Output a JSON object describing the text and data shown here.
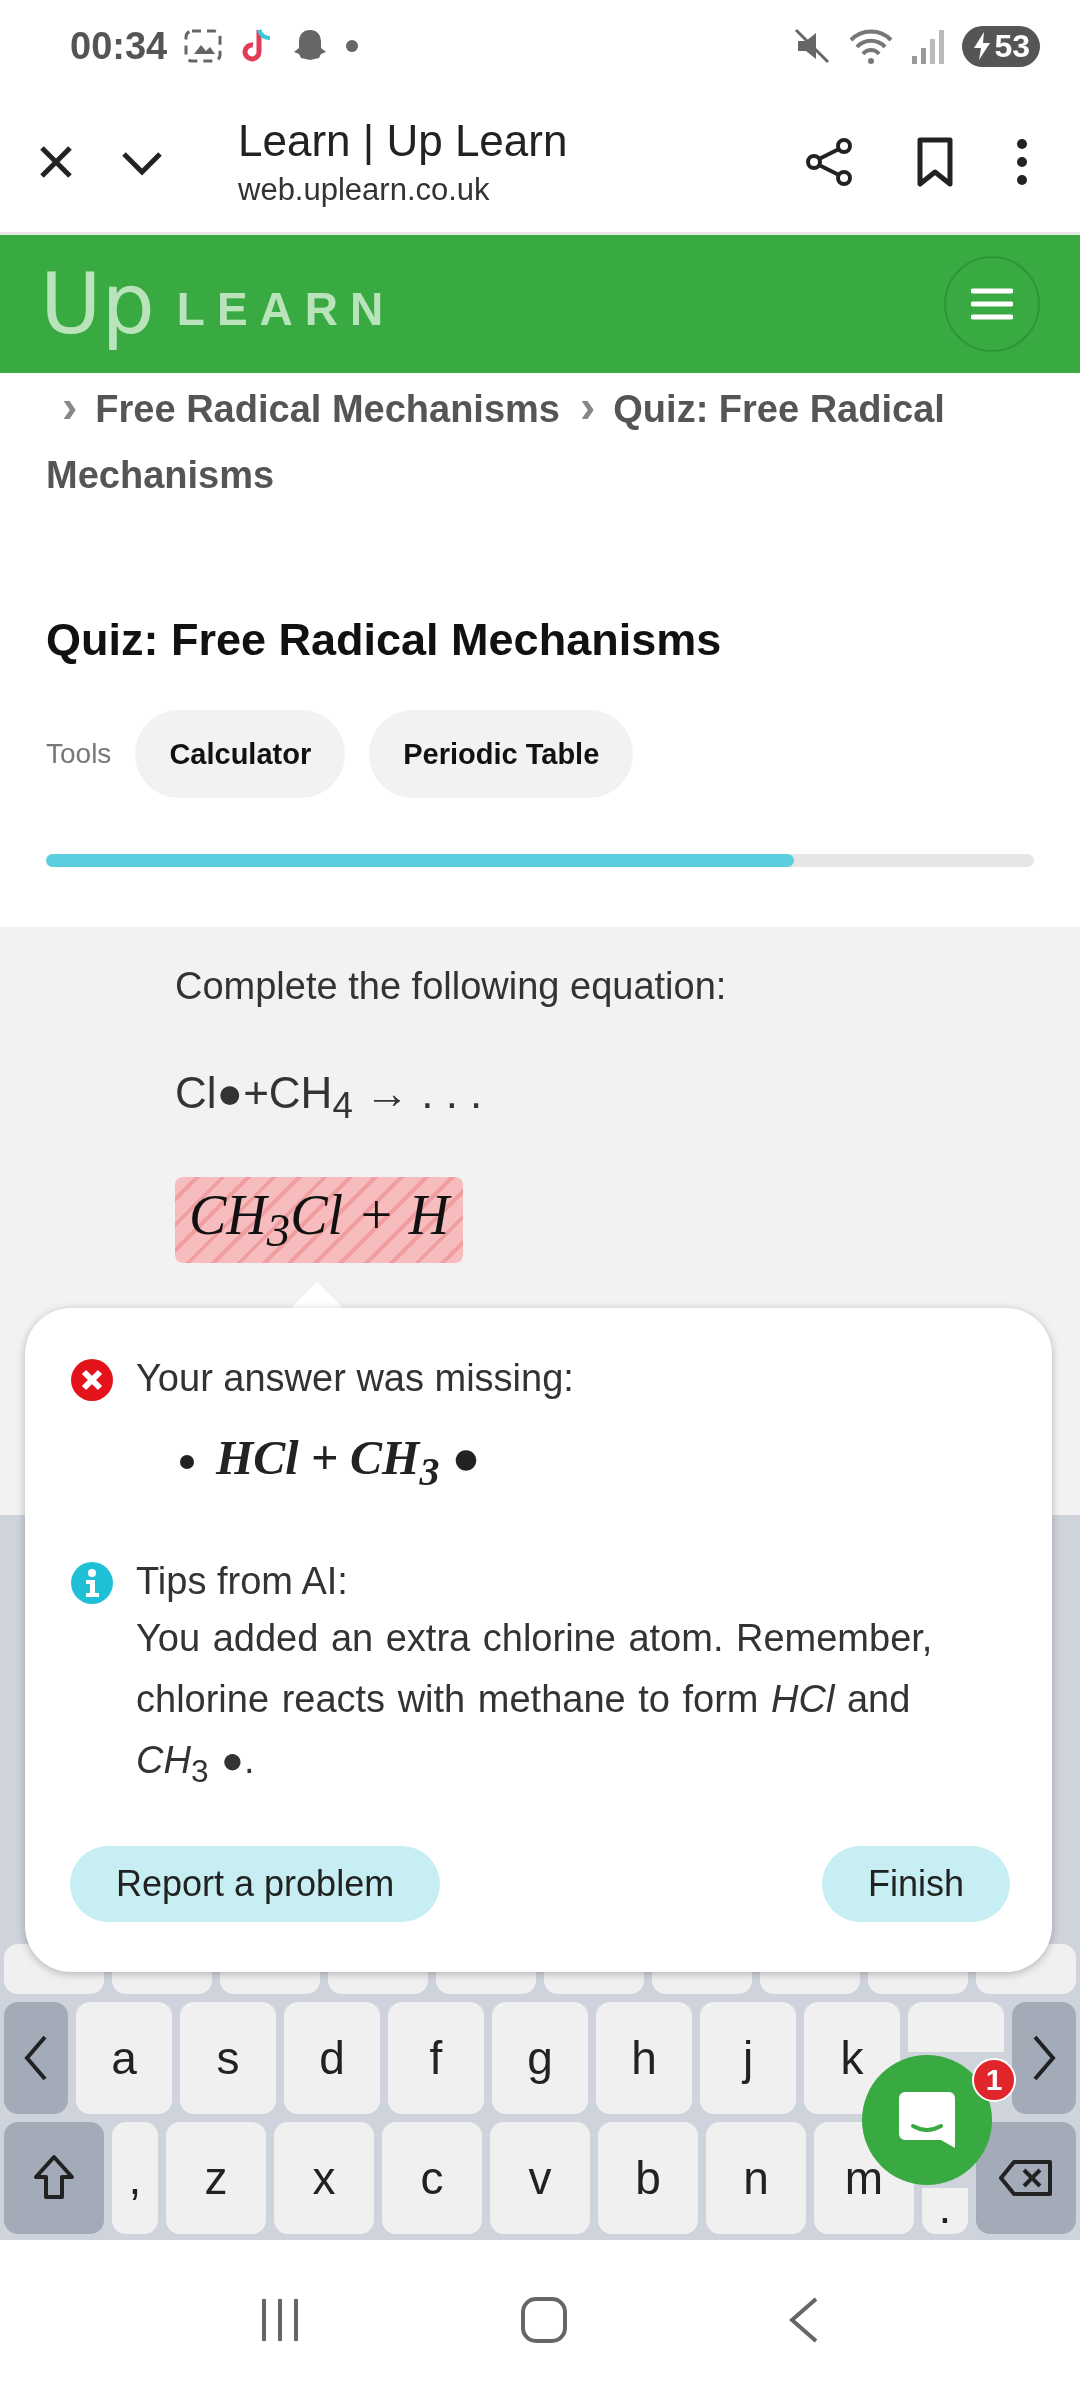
{
  "status_bar": {
    "time": "00:34",
    "battery": "53"
  },
  "browser_bar": {
    "title": "Learn | Up Learn",
    "url": "web.uplearn.co.uk"
  },
  "header": {
    "logo_mark": "Up",
    "logo_word": "LEARN"
  },
  "breadcrumbs": {
    "separator": "›",
    "items": [
      {
        "label": "Free Radical Mechanisms"
      },
      {
        "label": "Quiz: Free Radical Mechanisms"
      }
    ]
  },
  "quiz": {
    "title": "Quiz: Free Radical Mechanisms",
    "tools_label": "Tools",
    "tools": [
      "Calculator",
      "Periodic Table"
    ],
    "progress": {
      "level": 0.757
    }
  },
  "question": {
    "prompt": "Complete the following equation:",
    "equation": "Cl●+CH$_{4}$ → . . .",
    "answer": "CH$_{3}$Cl + H",
    "answer_correct": false
  },
  "feedback": {
    "missing_title": "Your answer was missing:",
    "missing_items": [
      "HCl + CH$_{3}$ ●"
    ],
    "tips_title": "Tips from AI:",
    "tips_text": "You added an extra chlorine atom. Remember, chlorine reacts with methane to form *HCl* and *CH*$_{3}$ ●.",
    "buttons": [
      {
        "kind": "report",
        "label": "Report a problem"
      },
      {
        "kind": "finish",
        "label": "Finish"
      }
    ]
  },
  "keyboard": {
    "rows": [
      {
        "keys": [
          {
            "kind": "blank"
          },
          {
            "kind": "blank"
          },
          {
            "kind": "blank"
          },
          {
            "kind": "blank"
          },
          {
            "kind": "blank"
          },
          {
            "kind": "blank"
          },
          {
            "kind": "blank"
          },
          {
            "kind": "blank"
          },
          {
            "kind": "blank"
          },
          {
            "kind": "blank"
          }
        ]
      },
      {
        "keys": [
          {
            "kind": "left"
          },
          {
            "kind": "letter",
            "label": "a"
          },
          {
            "kind": "letter",
            "label": "s"
          },
          {
            "kind": "letter",
            "label": "d"
          },
          {
            "kind": "letter",
            "label": "f"
          },
          {
            "kind": "letter",
            "label": "g"
          },
          {
            "kind": "letter",
            "label": "h"
          },
          {
            "kind": "letter",
            "label": "j"
          },
          {
            "kind": "letter",
            "label": "k"
          },
          {
            "kind": "covered_top"
          },
          {
            "kind": "right"
          }
        ]
      },
      {
        "keys": [
          {
            "kind": "shift"
          },
          {
            "kind": "small",
            "label": ","
          },
          {
            "kind": "letter",
            "label": "z"
          },
          {
            "kind": "letter",
            "label": "x"
          },
          {
            "kind": "letter",
            "label": "c"
          },
          {
            "kind": "letter",
            "label": "v"
          },
          {
            "kind": "letter",
            "label": "b"
          },
          {
            "kind": "letter",
            "label": "n"
          },
          {
            "kind": "letter",
            "label": "m"
          },
          {
            "kind": "covered_bottom",
            "label": "."
          },
          {
            "kind": "backspace"
          }
        ]
      }
    ]
  },
  "chat": {
    "badge": "1"
  }
}
